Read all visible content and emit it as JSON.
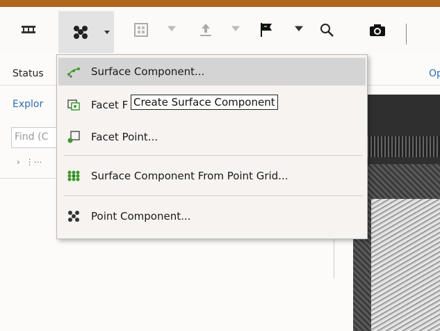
{
  "toolbar": {
    "buttons": [
      {
        "icon": "ruler-measure-icon"
      },
      {
        "icon": "point-component-icon",
        "active": true
      },
      {
        "icon": "grid-box-icon"
      },
      {
        "icon": "upload-arrow-icon"
      },
      {
        "icon": "flag-icon"
      },
      {
        "icon": "search-icon"
      },
      {
        "icon": "camera-icon"
      }
    ]
  },
  "left_panel": {
    "status_label": "Status",
    "explorer_label": "Explor",
    "find_placeholder": "Find (C"
  },
  "right_panel": {
    "open_label": "Oper"
  },
  "menu": {
    "items": [
      {
        "label": "Surface Component...",
        "icon": "surface-component-icon",
        "highlighted": true
      },
      {
        "label": "Facet F",
        "icon": "facet-icon"
      },
      {
        "label": "Facet Point...",
        "icon": "facet-point-icon"
      },
      {
        "label": "Surface Component From Point Grid...",
        "icon": "point-grid-icon"
      },
      {
        "label": "Point Component...",
        "icon": "point-component-icon"
      }
    ]
  },
  "tooltip": {
    "text": "Create Surface Component"
  },
  "colors": {
    "accent_bar": "#b0651c",
    "icon_green": "#3c9a2a",
    "link_blue": "#2d6db0",
    "menu_highlight": "#d4d4d4"
  }
}
